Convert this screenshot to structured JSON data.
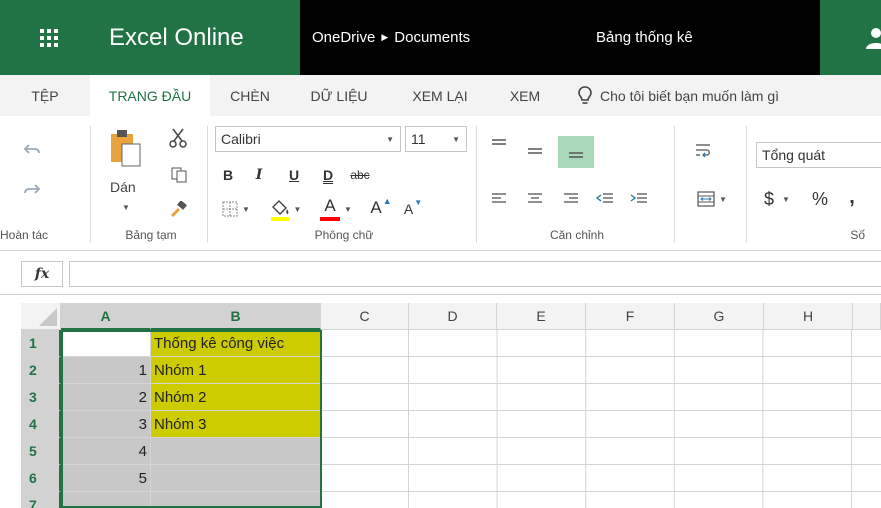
{
  "titlebar": {
    "app_name": "Excel Online",
    "breadcrumb": [
      "OneDrive",
      "Documents"
    ],
    "document_name": "Bảng thống kê",
    "brand_color": "#217346"
  },
  "ribbon_tabs": [
    {
      "label": "TỆP",
      "active": false
    },
    {
      "label": "TRANG ĐẦU",
      "active": true
    },
    {
      "label": "CHÈN",
      "active": false
    },
    {
      "label": "DỮ LIỆU",
      "active": false
    },
    {
      "label": "XEM LẠI",
      "active": false
    },
    {
      "label": "XEM",
      "active": false
    }
  ],
  "tell_me": {
    "text": "Cho tôi biết bạn muốn làm gì",
    "icon": "lightbulb-icon"
  },
  "ribbon": {
    "undo_group": {
      "label": "Hoàn tác",
      "icons": [
        "undo-icon",
        "redo-icon"
      ]
    },
    "clipboard_group": {
      "label": "Bảng tạm",
      "paste_label": "Dán",
      "icons": [
        "paste-icon",
        "cut-icon",
        "copy-icon",
        "format-painter-icon"
      ]
    },
    "font_group": {
      "label": "Phông chữ",
      "font_name": "Calibri",
      "font_size": "11",
      "format_buttons": {
        "bold": "B",
        "italic": "I",
        "underline": "U",
        "double_underline": "D",
        "strikethrough": "abc"
      },
      "font_color_letter": "A",
      "grow_letter": "A",
      "shrink_letter": "A",
      "fill_highlight_color": "#ffff00",
      "font_color": "#ff0000"
    },
    "alignment_group": {
      "label": "Căn chỉnh"
    },
    "number_group": {
      "label": "Số",
      "format": "Tổng quát",
      "currency": "$",
      "percent": "%",
      "comma": ","
    }
  },
  "formula_bar": {
    "fx_label": "fx",
    "value": ""
  },
  "sheet": {
    "columns": [
      "A",
      "B",
      "C",
      "D",
      "E",
      "F",
      "G",
      "H"
    ],
    "selected_columns": [
      "A",
      "B"
    ],
    "rows": [
      "1",
      "2",
      "3",
      "4",
      "5",
      "6",
      "7"
    ],
    "colA": [
      "",
      "1",
      "2",
      "3",
      "4",
      "5",
      ""
    ],
    "colB": [
      "Thống kê công việc",
      "Nhóm 1",
      "Nhóm 2",
      "Nhóm 3",
      "",
      "",
      ""
    ],
    "fill_gray": "#c8c8c8",
    "fill_olive": "#cccc00"
  }
}
